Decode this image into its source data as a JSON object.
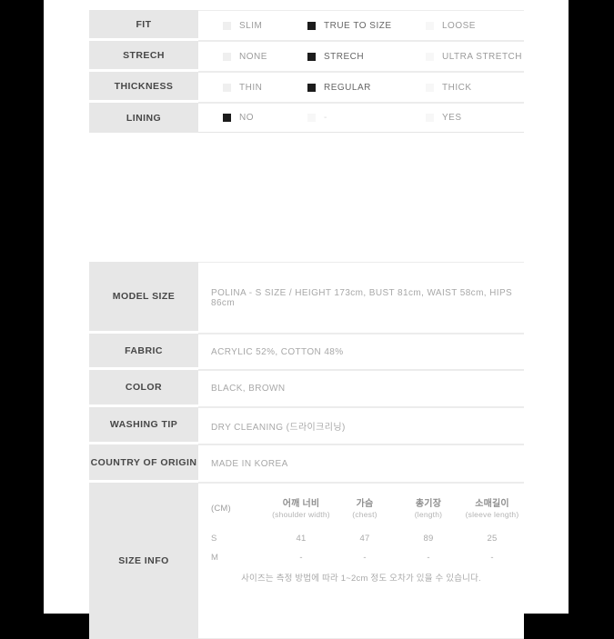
{
  "theme": {
    "page_background": "#ffffff",
    "outer_background": "#000000",
    "label_background": "#e7e7e7",
    "label_text": "#474747",
    "value_text": "#a8a8a8",
    "checkbox_on": "#1c1c1c",
    "checkbox_off": "#efefef"
  },
  "option_table": {
    "rows": [
      {
        "label": "FIT",
        "options": [
          {
            "text": "SLIM",
            "checked": false
          },
          {
            "text": "TRUE TO SIZE",
            "checked": true
          },
          {
            "text": "LOOSE",
            "checked": false
          }
        ]
      },
      {
        "label": "STRECH",
        "options": [
          {
            "text": "NONE",
            "checked": false
          },
          {
            "text": "STRECH",
            "checked": true
          },
          {
            "text": "ULTRA STRETCH",
            "checked": false
          }
        ]
      },
      {
        "label": "THICKNESS",
        "options": [
          {
            "text": "THIN",
            "checked": false
          },
          {
            "text": "REGULAR",
            "checked": true
          },
          {
            "text": "THICK",
            "checked": false
          }
        ]
      },
      {
        "label": "LINING",
        "options": [
          {
            "text": "NO",
            "checked": true
          },
          {
            "text": "-",
            "checked": false
          },
          {
            "text": "YES",
            "checked": false
          }
        ]
      }
    ]
  },
  "detail_table": {
    "model_size": {
      "label": "MODEL SIZE",
      "value": "POLINA - S SIZE / HEIGHT 173cm, BUST 81cm, WAIST 58cm, HIPS 86cm"
    },
    "fabric": {
      "label": "FABRIC",
      "value": "ACRYLIC 52%, COTTON 48%"
    },
    "color": {
      "label": "COLOR",
      "value": "BLACK, BROWN"
    },
    "washing_tip": {
      "label": "WASHING TIP",
      "value": "DRY CLEANING (드라이크리닝)"
    },
    "country_of_origin": {
      "label": "COUNTRY OF ORIGIN",
      "value": "MADE IN KOREA"
    },
    "size_info": {
      "label": "SIZE INFO",
      "unit_header": "(CM)",
      "columns": [
        {
          "ko": "어깨 너비",
          "en": "(shoulder width)"
        },
        {
          "ko": "가슴",
          "en": "(chest)"
        },
        {
          "ko": "총기장",
          "en": "(length)"
        },
        {
          "ko": "소매길이",
          "en": "(sleeve length)"
        }
      ],
      "rows": [
        {
          "size": "S",
          "values": [
            "41",
            "47",
            "89",
            "25"
          ]
        },
        {
          "size": "M",
          "values": [
            "-",
            "-",
            "-",
            "-"
          ]
        }
      ],
      "note": "사이즈는 측정 방법에 따라 1~2cm 정도 오차가 있을 수 있습니다."
    }
  }
}
